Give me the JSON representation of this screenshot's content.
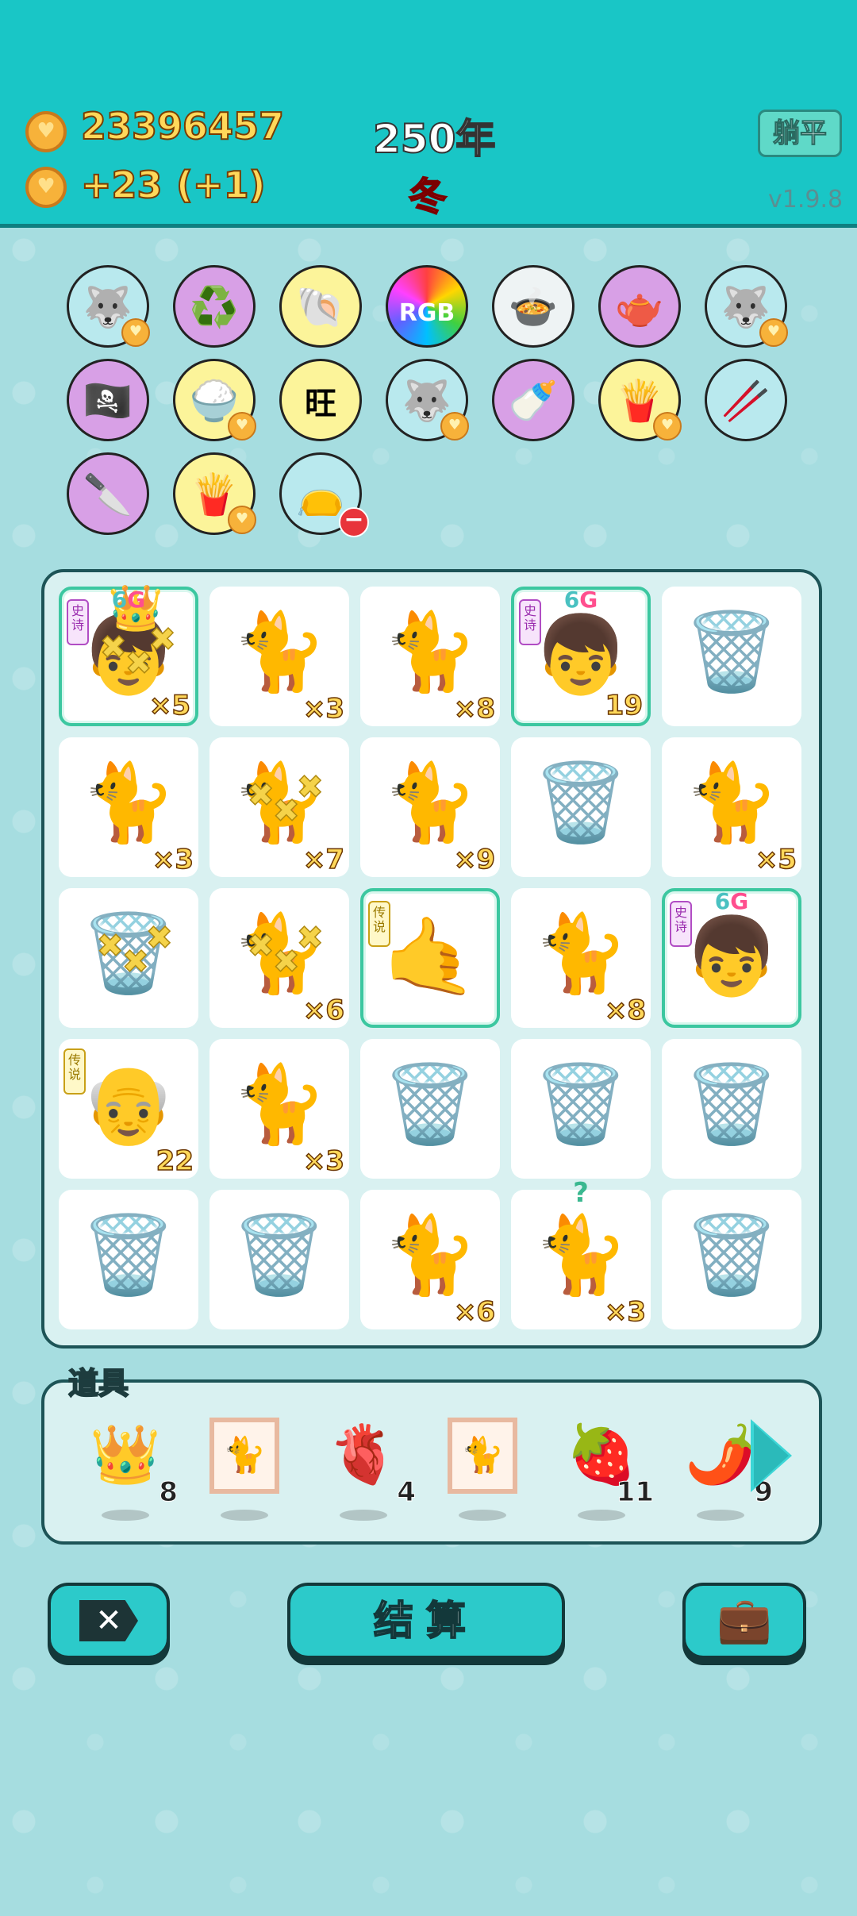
{
  "header": {
    "gold_total": "23396457",
    "gold_income": "+23",
    "gold_bonus": "(+1)",
    "year": "250年",
    "season": "冬",
    "lie_flat_button": "躺平",
    "version": "v1.9.8"
  },
  "items": [
    {
      "name": "husky-dog",
      "icon": "🐺",
      "bg": "blue",
      "heart": true
    },
    {
      "name": "recycle",
      "icon": "♻️",
      "bg": "purple"
    },
    {
      "name": "shell",
      "icon": "🐚",
      "bg": "yellow"
    },
    {
      "name": "rgb",
      "icon": "RGB",
      "bg": "rainbow"
    },
    {
      "name": "pot-duck",
      "icon": "🍲",
      "bg": "white"
    },
    {
      "name": "gravy-boat",
      "icon": "🫖",
      "bg": "purple"
    },
    {
      "name": "husky-dog-2",
      "icon": "🐺",
      "bg": "blue",
      "heart": true
    },
    {
      "name": "eyepatch",
      "icon": "🏴‍☠️",
      "bg": "purple"
    },
    {
      "name": "rice-bowl",
      "icon": "🍚",
      "bg": "yellow",
      "heart": true
    },
    {
      "name": "wang-tiles",
      "icon": "旺",
      "bg": "yellow"
    },
    {
      "name": "husky-dog-3",
      "icon": "🐺",
      "bg": "blue",
      "heart": true
    },
    {
      "name": "breast-pump",
      "icon": "🍼",
      "bg": "purple"
    },
    {
      "name": "fries",
      "icon": "🍟",
      "bg": "yellow",
      "heart": true
    },
    {
      "name": "chopsticks",
      "icon": "🥢",
      "bg": "blue"
    },
    {
      "name": "cleaver",
      "icon": "🔪",
      "bg": "purple"
    },
    {
      "name": "fries-2",
      "icon": "🍟",
      "bg": "yellow",
      "heart": true
    },
    {
      "name": "sack",
      "icon": "👝",
      "bg": "blue",
      "minus": true
    }
  ],
  "board": [
    {
      "kind": "king",
      "icon": "👦",
      "count": "×5",
      "tag": "史诗",
      "sixg": true,
      "crown": true,
      "hi": true,
      "x": true
    },
    {
      "kind": "cat",
      "icon": "🐈",
      "count": "×3"
    },
    {
      "kind": "cat",
      "icon": "🐈",
      "count": "×8"
    },
    {
      "kind": "boy",
      "icon": "👦",
      "count": "19",
      "tag": "史诗",
      "sixg": true,
      "hi": true
    },
    {
      "kind": "bag",
      "icon": "🗑️",
      "count": ""
    },
    {
      "kind": "cat",
      "icon": "🐈",
      "count": "×3"
    },
    {
      "kind": "cat",
      "icon": "🐈",
      "count": "×7",
      "x": true
    },
    {
      "kind": "cat",
      "icon": "🐈",
      "count": "×9"
    },
    {
      "kind": "bag",
      "icon": "🗑️",
      "count": ""
    },
    {
      "kind": "cat",
      "icon": "🐈",
      "count": "×5"
    },
    {
      "kind": "bag",
      "icon": "🗑️",
      "count": "",
      "x": true
    },
    {
      "kind": "cat",
      "icon": "🐈",
      "count": "×6",
      "x": true
    },
    {
      "kind": "hand",
      "icon": "🤙",
      "count": "",
      "tag": "传说",
      "legend": true,
      "hi": true
    },
    {
      "kind": "cat",
      "icon": "🐈",
      "count": "×8"
    },
    {
      "kind": "boy",
      "icon": "👦",
      "count": "",
      "tag": "史诗",
      "sixg": true,
      "hi": true
    },
    {
      "kind": "grandpa",
      "icon": "👴",
      "count": "22",
      "tag": "传说",
      "legend": true
    },
    {
      "kind": "cat",
      "icon": "🐈",
      "count": "×3"
    },
    {
      "kind": "bag",
      "icon": "🗑️",
      "count": ""
    },
    {
      "kind": "bag",
      "icon": "🗑️",
      "count": ""
    },
    {
      "kind": "bag",
      "icon": "🗑️",
      "count": ""
    },
    {
      "kind": "bag",
      "icon": "🗑️",
      "count": ""
    },
    {
      "kind": "bag",
      "icon": "🗑️",
      "count": ""
    },
    {
      "kind": "cat",
      "icon": "🐈",
      "count": "×6"
    },
    {
      "kind": "cat",
      "icon": "🐈",
      "count": "×3",
      "q": "?"
    },
    {
      "kind": "bag",
      "icon": "🗑️",
      "count": ""
    }
  ],
  "tools": {
    "title": "道具",
    "list": [
      {
        "name": "crown",
        "icon": "👑",
        "count": "8"
      },
      {
        "name": "cat-frame",
        "icon": "🐈",
        "count": "",
        "frame": true
      },
      {
        "name": "liver",
        "icon": "🫀",
        "count": "4"
      },
      {
        "name": "cat-frame-2",
        "icon": "🐈",
        "count": "",
        "frame": true
      },
      {
        "name": "strawberry",
        "icon": "🍓",
        "count": "11"
      },
      {
        "name": "chili",
        "icon": "🌶️",
        "count": "9"
      }
    ]
  },
  "buttons": {
    "close_icon": "✕",
    "settle": "结算",
    "bag_icon": "💼"
  },
  "colors": {
    "header_bg": "#19c6c6",
    "page_bg": "#a6dde0",
    "gold_text": "#ffd85a",
    "season_text": "#ff3a4a"
  }
}
